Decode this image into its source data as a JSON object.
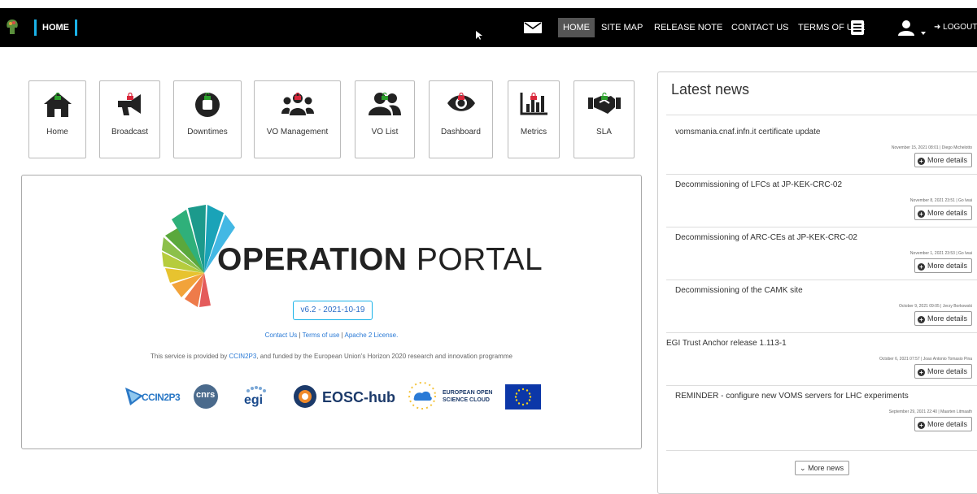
{
  "topbar": {
    "brand": "HOME",
    "nav": {
      "home": "HOME",
      "sitemap": "SITE MAP",
      "release": "RELEASE NOTE",
      "contact": "CONTACT US",
      "terms": "TERMS OF USE"
    },
    "logout": "LOGOUT"
  },
  "tiles": [
    {
      "label": "Home",
      "icon": "home-icon",
      "lock": "unlocked"
    },
    {
      "label": "Broadcast",
      "icon": "bullhorn-icon",
      "lock": "locked"
    },
    {
      "label": "Downtimes",
      "icon": "stop-circle-icon",
      "lock": "unlocked"
    },
    {
      "label": "VO Management",
      "icon": "users-icon",
      "lock": "locked"
    },
    {
      "label": "VO List",
      "icon": "user-friends-icon",
      "lock": "unlocked"
    },
    {
      "label": "Dashboard",
      "icon": "eye-icon",
      "lock": "locked"
    },
    {
      "label": "Metrics",
      "icon": "bar-chart-icon",
      "lock": "locked"
    },
    {
      "label": "SLA",
      "icon": "handshake-icon",
      "lock": "unlocked"
    }
  ],
  "portal": {
    "title_bold": "OPERATION",
    "title_light": "PORTAL",
    "version": "v6.2 - 2021-10-19",
    "links": {
      "contact": "Contact Us",
      "sep": "|",
      "terms": "Terms of use",
      "license": "Apache 2 License."
    },
    "provided": {
      "prefix": "This service is provided by",
      "link": "CCIN2P3",
      "suffix": ", and funded by the European Union's Horizon 2020 research and innovation programme"
    },
    "partners": {
      "ccin2p3": "CCIN2P3",
      "cnrs": "cnrs",
      "egi": "egi",
      "eosc_hub": "EOSC-hub",
      "eosc_line1": "EUROPEAN OPEN",
      "eosc_line2": "SCIENCE CLOUD"
    }
  },
  "news": {
    "title": "Latest news",
    "more_label": "More details",
    "more_news_label": "More news",
    "items": [
      {
        "headline": "vomsmania.cnaf.infn.it certificate update",
        "meta": "November 15, 2021 08:01 | Diego Michelotto"
      },
      {
        "headline": "Decommissioning of LFCs at JP-KEK-CRC-02",
        "meta": "November 8, 2021 23:51 | Go Iwai"
      },
      {
        "headline": "Decommissioning of ARC-CEs at JP-KEK-CRC-02",
        "meta": "November 1, 2021 23:53 | Go Iwai"
      },
      {
        "headline": "Decommissioning of the CAMK site",
        "meta": "October 9, 2021 09:05 | Jerzy Borkowski"
      },
      {
        "headline": "EGI Trust Anchor release 1.113-1",
        "meta": "October 6, 2021 07:57 | Joao Antonio Tomasio Pina"
      },
      {
        "headline": "REMINDER - configure new VOMS servers for LHC experiments",
        "meta": "September 29, 2021 22:40 | Maarten Litmaath"
      }
    ]
  },
  "colors": {
    "accent": "#1ab2e8",
    "locked": "#d9263a",
    "unlocked": "#2da02d",
    "link": "#2a7ad6"
  }
}
